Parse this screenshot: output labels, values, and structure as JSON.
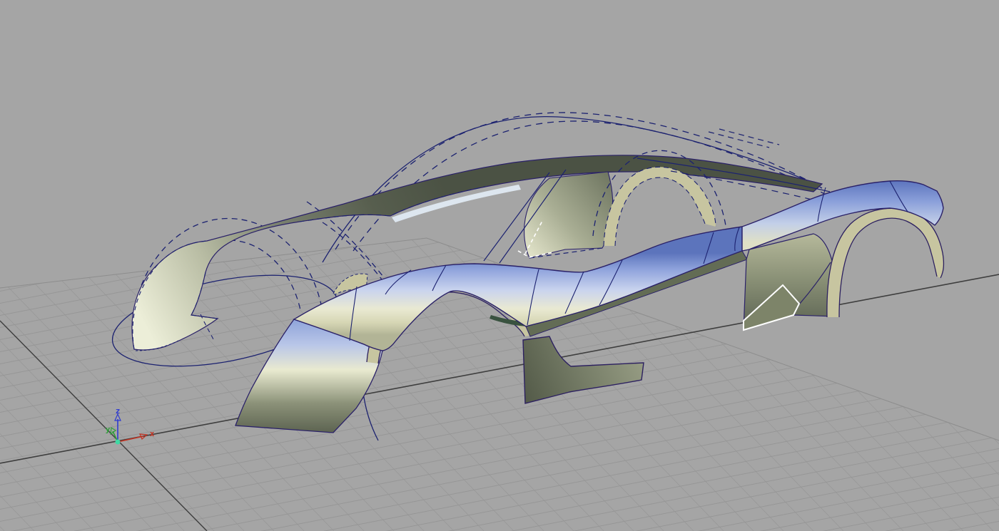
{
  "viewport": {
    "type": "3d-cad-perspective-viewport",
    "description": "Automotive body-side surface model (supercar) over ground grid with construction curves",
    "background_color": "#a5a5a5"
  },
  "ground": {
    "grid_minor_color": "#969696",
    "grid_edge_color": "#8d8d8d",
    "axis_line_color": "#3e3e3e"
  },
  "axis_gizmo": {
    "x_label": "x",
    "y_label": "y",
    "z_label": "z",
    "x_color": "#c23322",
    "y_color": "#2e9e38",
    "z_color": "#2f3bd0",
    "origin_color": "#3fd9a4"
  },
  "model": {
    "curve_color": "#1c2270",
    "edge_color": "#2a2168",
    "arch_edge_color": "#2c2060",
    "trim_color": "#c7c5a0",
    "sheen_color": "#dde6ef",
    "selection_edge_color": "#ffffff",
    "far_body_parts": [
      "front-fender-blade",
      "front-wheel-curve",
      "front-wheel-arch-dashed",
      "a-pillar-roof-band",
      "roof-sheen-stripe",
      "quarter-panel",
      "b-pillar-curves",
      "rear-wheel-arch-trim",
      "rear-wheel-arch-dashed",
      "roofline-curves",
      "windshield-curves",
      "rear-deck-lines",
      "cowl-patch"
    ],
    "near_body_parts": [
      "rear-corner-panel",
      "rear-wheel-arch-trim",
      "rear-wheel-curve",
      "rocker-panel",
      "sill-strip",
      "beltline-panel",
      "front-bumper-panel",
      "selected-bumper-patch",
      "front-wheel-arch-trim",
      "front-fender-panel",
      "panel-seams"
    ]
  }
}
